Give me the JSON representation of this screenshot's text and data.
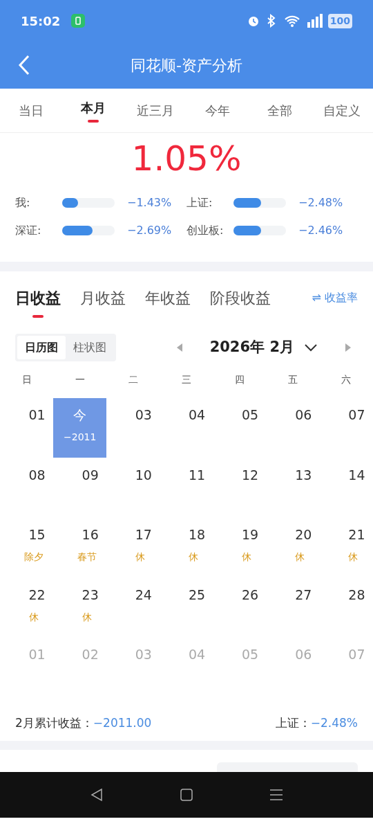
{
  "status_bar": {
    "time": "15:02",
    "battery": "100"
  },
  "header": {
    "title": "同花顺-资产分析"
  },
  "period_tabs": [
    {
      "label": "当日",
      "selected": false
    },
    {
      "label": "本月",
      "selected": true
    },
    {
      "label": "近三月",
      "selected": false
    },
    {
      "label": "今年",
      "selected": false
    },
    {
      "label": "全部",
      "selected": false
    },
    {
      "label": "自定义",
      "selected": false
    }
  ],
  "headline": "1.05%",
  "comparisons": [
    {
      "name": "我:",
      "level": 0.3,
      "reading": "−1.43%"
    },
    {
      "name": "上证:",
      "level": 0.52,
      "reading": "−2.48%"
    },
    {
      "name": "深证:",
      "level": 0.58,
      "reading": "−2.69%"
    },
    {
      "name": "创业板:",
      "level": 0.52,
      "reading": "−2.46%"
    }
  ],
  "income_tabs": [
    {
      "label": "日收益",
      "selected": true
    },
    {
      "label": "月收益",
      "selected": false
    },
    {
      "label": "年收益",
      "selected": false
    },
    {
      "label": "阶段收益",
      "selected": false
    }
  ],
  "switch_link": {
    "icon": "⇌",
    "label": "收益率"
  },
  "view_toggle": [
    {
      "label": "日历图",
      "selected": true
    },
    {
      "label": "柱状图",
      "selected": false
    }
  ],
  "month": {
    "label": "2026年 2月"
  },
  "weekdays": [
    "日",
    "一",
    "二",
    "三",
    "四",
    "五",
    "六"
  ],
  "days": [
    {
      "day": "01",
      "muted": false,
      "selected": false
    },
    {
      "day": "今",
      "sub": "−2011",
      "muted": false,
      "selected": true
    },
    {
      "day": "03",
      "muted": false,
      "selected": false
    },
    {
      "day": "04",
      "muted": false,
      "selected": false
    },
    {
      "day": "05",
      "muted": false,
      "selected": false
    },
    {
      "day": "06",
      "muted": false,
      "selected": false
    },
    {
      "day": "07",
      "muted": false,
      "selected": false
    },
    {
      "day": "08",
      "muted": false,
      "selected": false
    },
    {
      "day": "09",
      "muted": false,
      "selected": false
    },
    {
      "day": "10",
      "muted": false,
      "selected": false
    },
    {
      "day": "11",
      "muted": false,
      "selected": false
    },
    {
      "day": "12",
      "muted": false,
      "selected": false
    },
    {
      "day": "13",
      "muted": false,
      "selected": false
    },
    {
      "day": "14",
      "muted": false,
      "selected": false
    },
    {
      "day": "15",
      "sub": "除夕",
      "muted": false,
      "selected": false
    },
    {
      "day": "16",
      "sub": "春节",
      "muted": false,
      "selected": false
    },
    {
      "day": "17",
      "sub": "休",
      "muted": false,
      "selected": false
    },
    {
      "day": "18",
      "sub": "休",
      "muted": false,
      "selected": false
    },
    {
      "day": "19",
      "sub": "休",
      "muted": false,
      "selected": false
    },
    {
      "day": "20",
      "sub": "休",
      "muted": false,
      "selected": false
    },
    {
      "day": "21",
      "sub": "休",
      "muted": false,
      "selected": false
    },
    {
      "day": "22",
      "sub": "休",
      "muted": false,
      "selected": false
    },
    {
      "day": "23",
      "sub": "休",
      "muted": false,
      "selected": false
    },
    {
      "day": "24",
      "muted": false,
      "selected": false
    },
    {
      "day": "25",
      "muted": false,
      "selected": false
    },
    {
      "day": "26",
      "muted": false,
      "selected": false
    },
    {
      "day": "27",
      "muted": false,
      "selected": false
    },
    {
      "day": "28",
      "muted": false,
      "selected": false
    },
    {
      "day": "01",
      "muted": true,
      "selected": false
    },
    {
      "day": "02",
      "muted": true,
      "selected": false
    },
    {
      "day": "03",
      "muted": true,
      "selected": false
    },
    {
      "day": "04",
      "muted": true,
      "selected": false
    },
    {
      "day": "05",
      "muted": true,
      "selected": false
    },
    {
      "day": "06",
      "muted": true,
      "selected": false
    },
    {
      "day": "07",
      "muted": true,
      "selected": false
    }
  ],
  "summary": {
    "label": "2月累计收益：",
    "value": "−2011.00",
    "index_label": "上证：",
    "index_value": "−2.48%"
  }
}
